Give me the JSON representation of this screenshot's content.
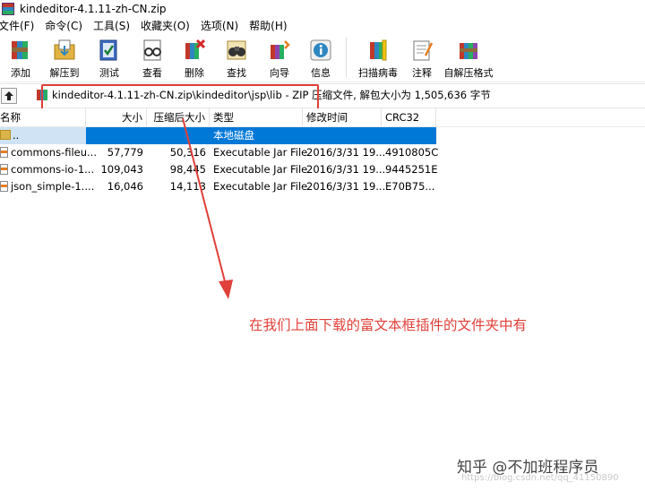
{
  "window": {
    "title": "kindeditor-4.1.11-zh-CN.zip"
  },
  "menu": [
    "文件(F)",
    "命令(C)",
    "工具(S)",
    "收藏夹(O)",
    "选项(N)",
    "帮助(H)"
  ],
  "toolbar": {
    "add": "添加",
    "extract_to": "解压到",
    "test": "测试",
    "view": "查看",
    "delete": "删除",
    "find": "查找",
    "wizard": "向导",
    "info": "信息",
    "virus_scan": "扫描病毒",
    "comment": "注释",
    "sfx": "自解压格式"
  },
  "address": {
    "path": "kindeditor-4.1.11-zh-CN.zip\\kindeditor\\jsp\\lib - ZIP 压缩文件, 解包大小为 1,505,636 字节"
  },
  "table": {
    "columns": [
      "名称",
      "大小",
      "压缩后大小",
      "类型",
      "修改时间",
      "CRC32"
    ],
    "rows": [
      {
        "name": "..",
        "size": "",
        "packed": "",
        "type": "本地磁盘",
        "modified": "",
        "crc": ""
      },
      {
        "name": "commons-fileu...",
        "size": "57,779",
        "packed": "50,316",
        "type": "Executable Jar File",
        "modified": "2016/3/31 19...",
        "crc": "4910805C"
      },
      {
        "name": "commons-io-1...",
        "size": "109,043",
        "packed": "98,445",
        "type": "Executable Jar File",
        "modified": "2016/3/31 19...",
        "crc": "9445251E"
      },
      {
        "name": "json_simple-1....",
        "size": "16,046",
        "packed": "14,113",
        "type": "Executable Jar File",
        "modified": "2016/3/31 19...",
        "crc": "E70B75..."
      }
    ]
  },
  "annotation": {
    "text": "在我们上面下载的富文本框插件的文件夹中有"
  },
  "watermark": {
    "text": "知乎 @不加班程序员",
    "sub": "https://blog.csdn.net/qq_41150890"
  },
  "colors": {
    "annotation_red": "#e0403a",
    "selection_blue": "#0078d7"
  }
}
